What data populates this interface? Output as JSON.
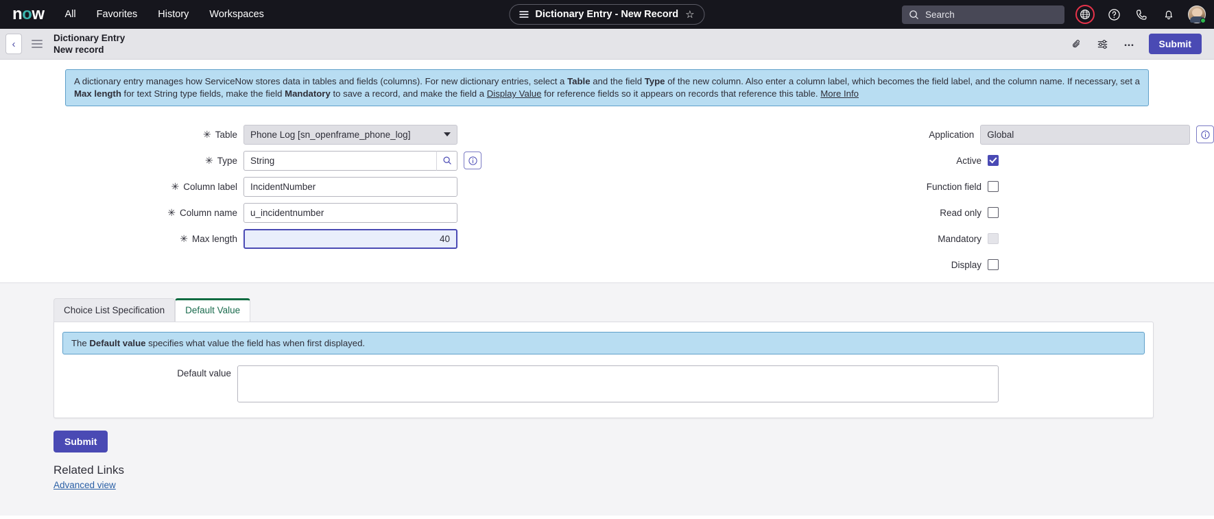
{
  "topnav": {
    "logo": "now",
    "logo_first": "n",
    "logo_mid": "o",
    "logo_last": "w",
    "links": [
      {
        "label": "All"
      },
      {
        "label": "Favorites"
      },
      {
        "label": "History"
      },
      {
        "label": "Workspaces"
      }
    ],
    "title_pill": "Dictionary Entry - New Record",
    "star": "☆",
    "search_placeholder": "Search",
    "icons": [
      {
        "name": "globe-icon",
        "glyph": "globe",
        "highlighted": true
      },
      {
        "name": "help-icon",
        "glyph": "help",
        "highlighted": false
      },
      {
        "name": "phone-icon",
        "glyph": "phone",
        "highlighted": false
      },
      {
        "name": "bell-icon",
        "glyph": "bell",
        "highlighted": false
      }
    ]
  },
  "subbar": {
    "back": "‹",
    "breadcrumb_line1": "Dictionary Entry",
    "breadcrumb_line2": "New record",
    "submit_label": "Submit",
    "tool_icons": [
      "attachment-icon",
      "personalize-icon",
      "more-icon"
    ]
  },
  "banner": {
    "part1": "A dictionary entry manages how ServiceNow stores data in tables and fields (columns). For new dictionary entries, select a ",
    "b1": "Table",
    "part2": " and the field ",
    "b2": "Type",
    "part3": " of the new column. Also enter a column label, which becomes the field label, and the column name. If necessary, set a ",
    "b3": "Max length",
    "part4": " for text String type fields, make the field ",
    "b4": "Mandatory",
    "part5": " to save a record, and make the field a ",
    "link1": "Display Value",
    "part6": " for reference fields so it appears on records that reference this table. ",
    "link2": "More Info"
  },
  "form": {
    "left": [
      {
        "label": "Table",
        "required": true,
        "type": "select",
        "value": "Phone Log [sn_openframe_phone_log]",
        "name": "table-field"
      },
      {
        "label": "Type",
        "required": true,
        "type": "reference",
        "value": "String",
        "name": "type-field"
      },
      {
        "label": "Column label",
        "required": true,
        "type": "text",
        "value": "IncidentNumber",
        "name": "column-label-field"
      },
      {
        "label": "Column name",
        "required": true,
        "type": "text",
        "value": "u_incidentnumber",
        "name": "column-name-field"
      },
      {
        "label": "Max length",
        "required": true,
        "type": "number-focused",
        "value": "40",
        "name": "max-length-field"
      }
    ],
    "right": [
      {
        "label": "Application",
        "required": false,
        "type": "readonly",
        "value": "Global",
        "name": "application-field"
      },
      {
        "label": "Active",
        "required": false,
        "type": "checkbox",
        "checked": true,
        "disabled": false,
        "name": "active-checkbox"
      },
      {
        "label": "Function field",
        "required": false,
        "type": "checkbox",
        "checked": false,
        "disabled": false,
        "name": "function-field-checkbox"
      },
      {
        "label": "Read only",
        "required": false,
        "type": "checkbox",
        "checked": false,
        "disabled": false,
        "name": "read-only-checkbox"
      },
      {
        "label": "Mandatory",
        "required": false,
        "type": "checkbox",
        "checked": false,
        "disabled": true,
        "name": "mandatory-checkbox"
      },
      {
        "label": "Display",
        "required": false,
        "type": "checkbox",
        "checked": false,
        "disabled": false,
        "name": "display-checkbox"
      }
    ],
    "required_marker": "✳"
  },
  "tabs": [
    {
      "label": "Choice List Specification",
      "active": false
    },
    {
      "label": "Default Value",
      "active": true
    }
  ],
  "default_value_panel": {
    "banner_pre": "The ",
    "banner_bold": "Default value",
    "banner_post": " specifies what value the field has when first displayed.",
    "field_label": "Default value",
    "field_value": "",
    "field_placeholder": ""
  },
  "footer": {
    "submit_label": "Submit",
    "related_links_title": "Related Links",
    "advanced_view": "Advanced view"
  },
  "colors": {
    "accent_purple": "#4a4ab4",
    "banner_blue": "#b8ddf2",
    "active_tab_green": "#0f6b41",
    "topbar_dark": "#16161d",
    "highlight_red": "#e8334a"
  }
}
